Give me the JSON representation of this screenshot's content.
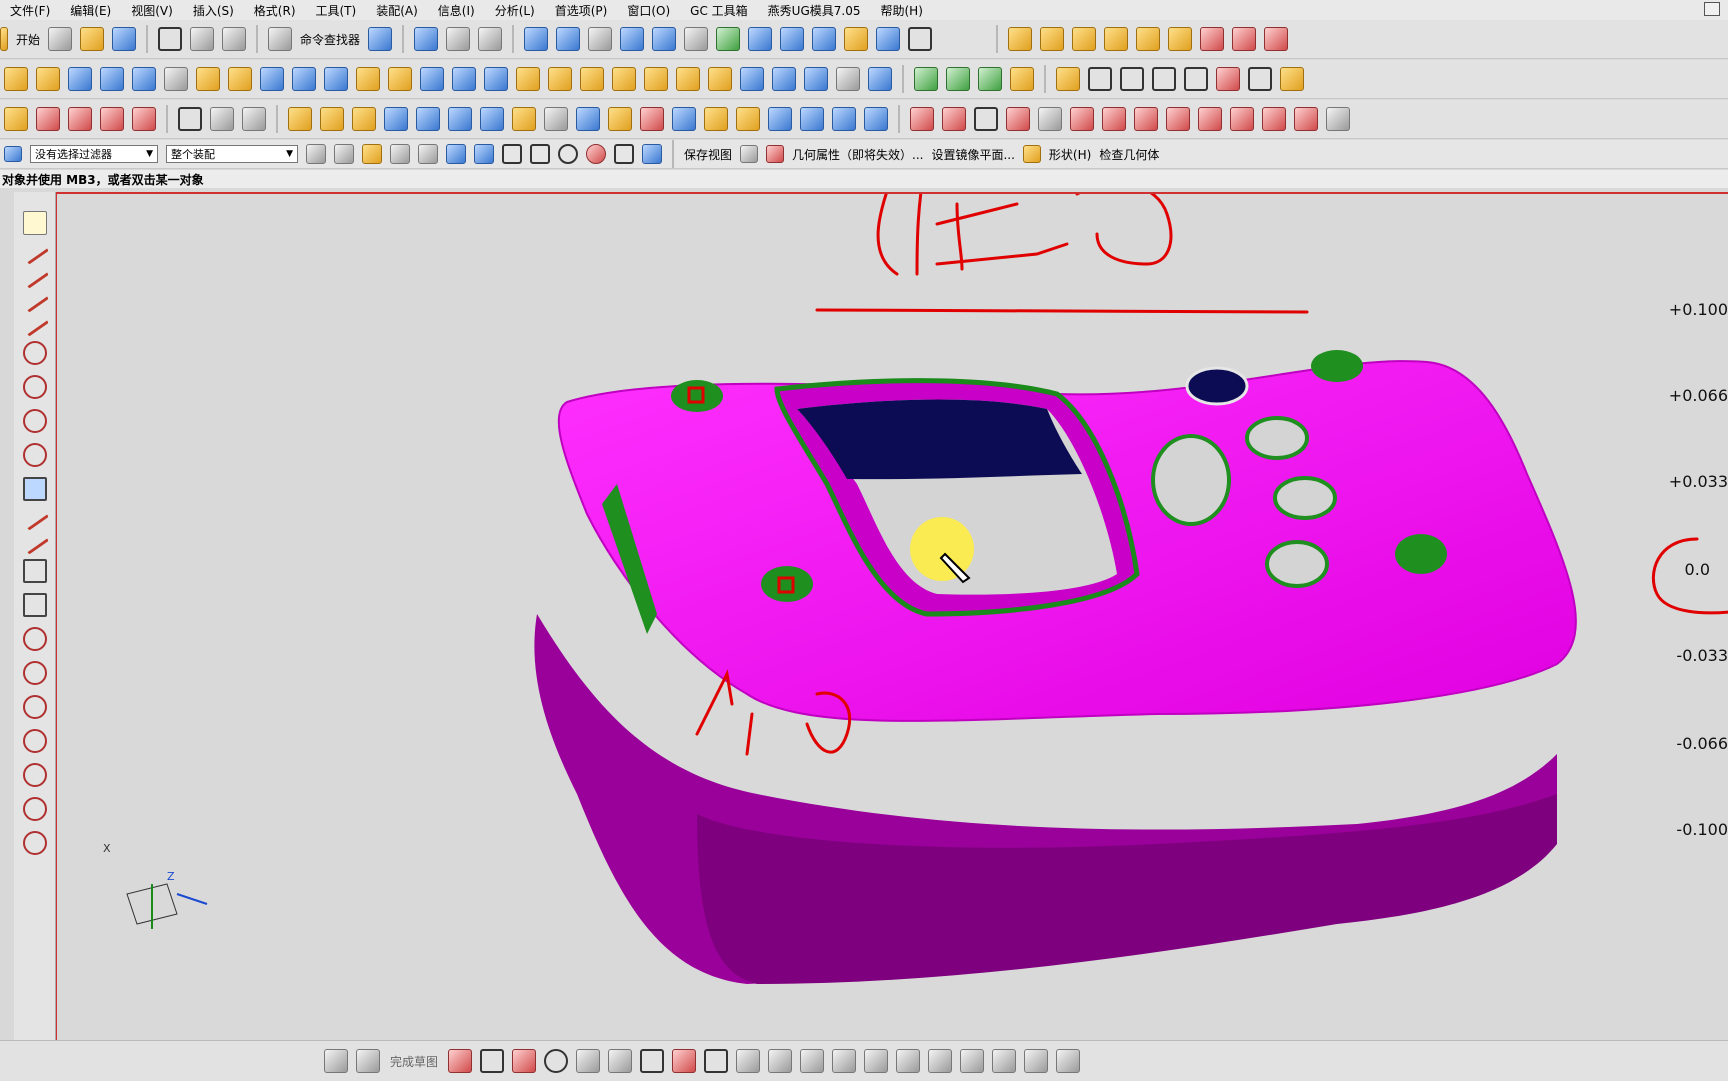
{
  "menu": [
    "文件(F)",
    "编辑(E)",
    "视图(V)",
    "插入(S)",
    "格式(R)",
    "工具(T)",
    "装配(A)",
    "信息(I)",
    "分析(L)",
    "首选项(P)",
    "窗口(O)",
    "GC 工具箱",
    "燕秀UG模具7.05",
    "帮助(H)"
  ],
  "toolbar1": {
    "start_label": "开始",
    "command_finder": "命令查找器"
  },
  "filter": {
    "type_value": "没有选择过滤器",
    "scope_value": "整个装配"
  },
  "toolbar4": {
    "save_view": "保存视图",
    "geometry_attr": "几何属性（即将失效）...",
    "mirror_plane": "设置镜像平面...",
    "shape": "形状(H)",
    "check_geometry": "检查几何体"
  },
  "status": {
    "prompt": "对象并使用 MB3，或者双击某一对象"
  },
  "scale": [
    "+0.100",
    "+0.066",
    "+0.033",
    "0.0",
    "-0.033",
    "-0.066",
    "-0.100"
  ],
  "triad": {
    "axis_x": "X",
    "axis_z": "Z"
  },
  "bottom": {
    "finish_sketch": "完成草图"
  },
  "colors": {
    "model": "#e400e4",
    "holes": "#1f8f1f",
    "annotation": "#e00000",
    "highlight": "#ffef3a"
  }
}
